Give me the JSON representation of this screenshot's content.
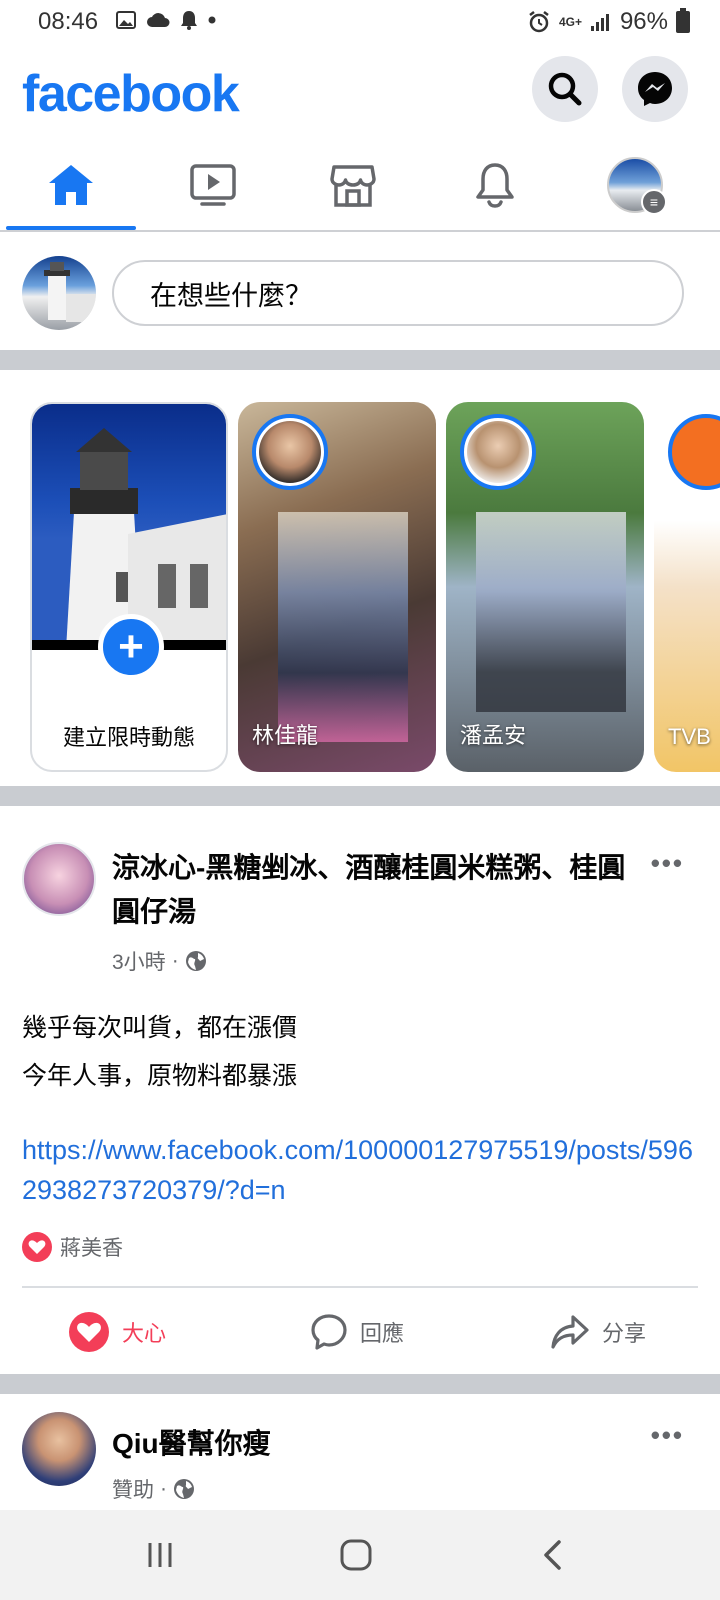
{
  "status_bar": {
    "time": "08:46",
    "battery": "96%",
    "network": "4G+"
  },
  "header": {
    "logo": "facebook"
  },
  "composer": {
    "placeholder": "在想些什麼？"
  },
  "stories": {
    "create_label": "建立限時動態",
    "items": [
      {
        "name": "林佳龍"
      },
      {
        "name": "潘孟安"
      },
      {
        "name": "TVB"
      }
    ]
  },
  "post": {
    "page_name": "涼冰心-黑糖剉冰、酒釀桂圓米糕粥、桂圓圓仔湯",
    "time": "3小時",
    "body_lines": [
      "幾乎每次叫貨，都在漲價",
      "今年人事，原物料都暴漲"
    ],
    "link": "https://www.facebook.com/100000127975519/posts/5962938273720379/?d=n",
    "reacted_by": "蔣美香",
    "actions": {
      "love": "大心",
      "comment": "回應",
      "share": "分享"
    }
  },
  "post2": {
    "page_name": "Qiu醫幫你瘦",
    "meta": "贊助"
  },
  "colors": {
    "accent": "#1877f2",
    "love": "#f33e58",
    "link": "#216fdb"
  }
}
